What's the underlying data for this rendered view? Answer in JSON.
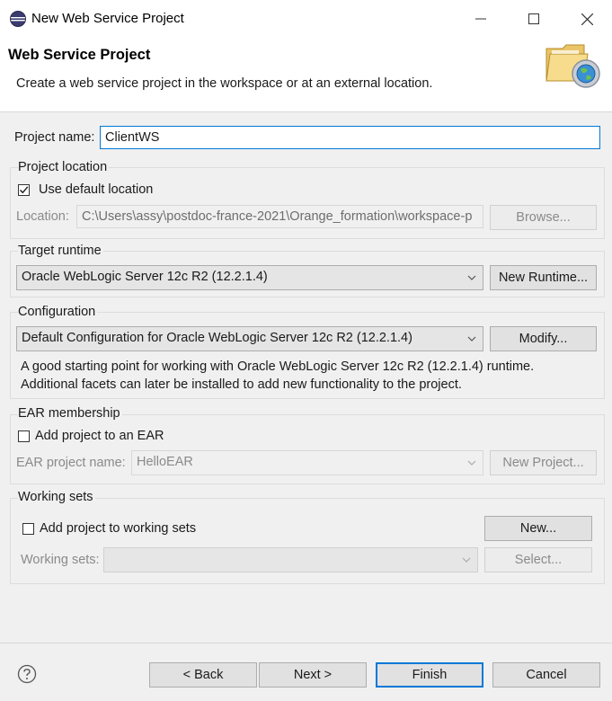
{
  "window": {
    "title": "New Web Service Project",
    "app_icon": "eclipse-icon",
    "minimize_icon": "minimize-icon",
    "maximize_icon": "maximize-icon",
    "close_icon": "close-icon"
  },
  "header": {
    "title": "Web Service Project",
    "description": "Create a web service project in the workspace or at an external location.",
    "banner_icon": "folder-globe-icon"
  },
  "project_name": {
    "label": "Project name:",
    "value": "ClientWS"
  },
  "project_location": {
    "title": "Project location",
    "use_default_label": "Use default location",
    "use_default_checked": true,
    "location_label": "Location:",
    "location_value": "C:\\Users\\assy\\postdoc-france-2021\\Orange_formation\\workspace-p",
    "browse_label": "Browse..."
  },
  "target_runtime": {
    "title": "Target runtime",
    "selected": "Oracle WebLogic Server 12c R2 (12.2.1.4)",
    "new_runtime_label": "New Runtime..."
  },
  "configuration": {
    "title": "Configuration",
    "selected": "Default Configuration for Oracle WebLogic Server 12c R2 (12.2.1.4)",
    "modify_label": "Modify...",
    "description_line1": "A good starting point for working with Oracle WebLogic Server 12c R2 (12.2.1.4) runtime.",
    "description_line2": "Additional facets can later be installed to add new functionality to the project."
  },
  "ear_membership": {
    "title": "EAR membership",
    "add_label": "Add project to an EAR",
    "add_checked": false,
    "ear_name_label": "EAR project name:",
    "ear_name_value": "HelloEAR",
    "new_project_label": "New Project..."
  },
  "working_sets": {
    "title": "Working sets",
    "add_label": "Add project to working sets",
    "add_checked": false,
    "new_label": "New...",
    "sets_label": "Working sets:",
    "sets_value": "",
    "select_label": "Select..."
  },
  "footer": {
    "help_icon": "help-icon",
    "back_label": "< Back",
    "next_label": "Next >",
    "finish_label": "Finish",
    "cancel_label": "Cancel"
  },
  "colors": {
    "focus_accent": "#0078d7",
    "dialog_background": "#f0f0f0"
  }
}
